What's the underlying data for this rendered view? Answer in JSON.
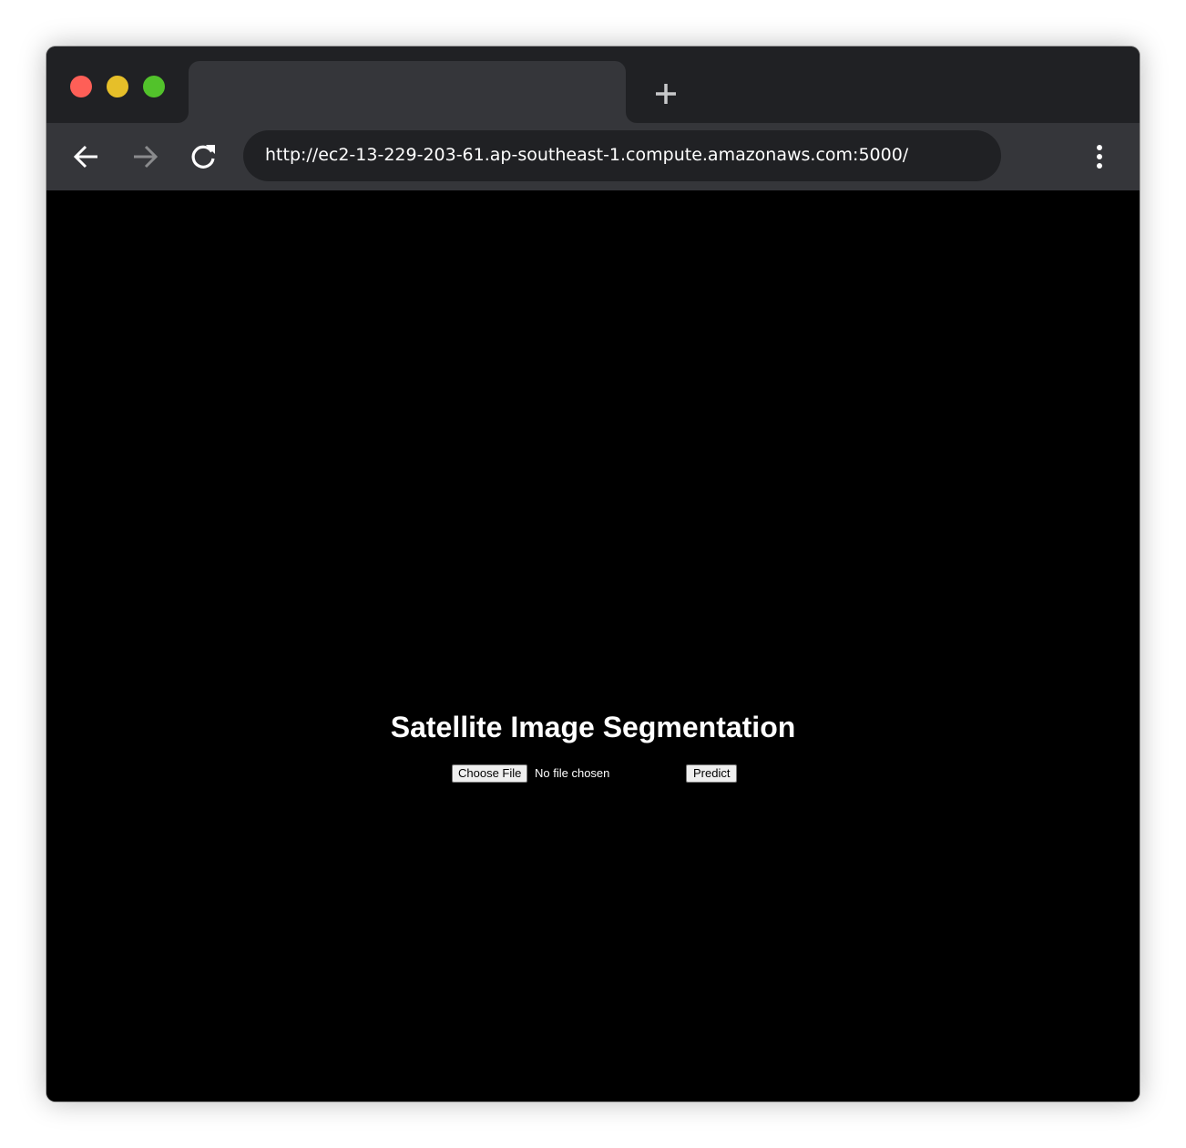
{
  "browser": {
    "url": "http://ec2-13-229-203-61.ap-southeast-1.compute.amazonaws.com:5000/",
    "tab_title": "",
    "colors": {
      "titlebar": "#202124",
      "toolbar": "#35363a",
      "omnibox": "#202124",
      "close": "#fe5f57",
      "minimize": "#e6bf29",
      "maximize": "#52c22b"
    },
    "icons": {
      "back": "arrow-left-icon",
      "forward": "arrow-right-icon",
      "reload": "reload-icon",
      "new_tab": "plus-icon",
      "menu": "kebab-menu-icon"
    }
  },
  "page": {
    "background": "#000000",
    "title": "Satellite Image Segmentation",
    "upload": {
      "choose_label": "Choose File",
      "status": "No file chosen"
    },
    "predict_label": "Predict"
  }
}
